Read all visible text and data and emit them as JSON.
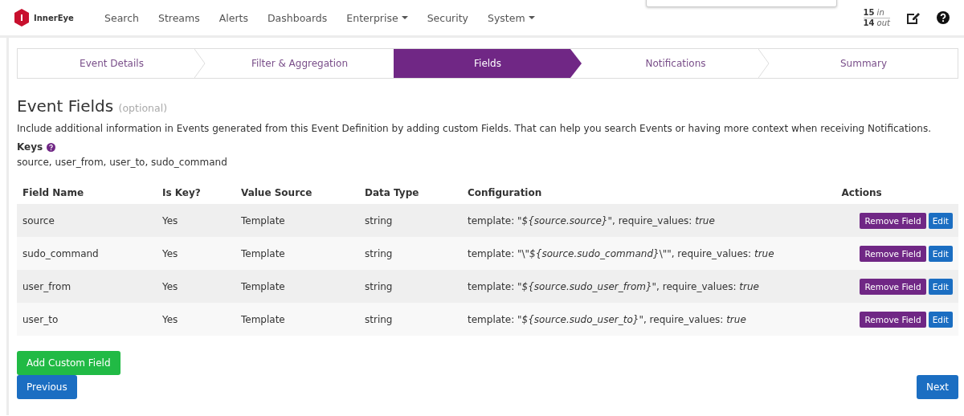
{
  "brand": "InnerEye",
  "nav": [
    {
      "label": "Search",
      "dropdown": false
    },
    {
      "label": "Streams",
      "dropdown": false
    },
    {
      "label": "Alerts",
      "dropdown": false
    },
    {
      "label": "Dashboards",
      "dropdown": false
    },
    {
      "label": "Enterprise",
      "dropdown": true
    },
    {
      "label": "Security",
      "dropdown": false
    },
    {
      "label": "System",
      "dropdown": true
    }
  ],
  "throughput": {
    "in_count": "15",
    "in_label": "in",
    "out_count": "14",
    "out_label": "out"
  },
  "steps": [
    {
      "label": "Event Details",
      "selected": false
    },
    {
      "label": "Filter & Aggregation",
      "selected": false
    },
    {
      "label": "Fields",
      "selected": true
    },
    {
      "label": "Notifications",
      "selected": false
    },
    {
      "label": "Summary",
      "selected": false
    }
  ],
  "heading": {
    "title": "Event Fields",
    "note": "(optional)"
  },
  "description": "Include additional information in Events generated from this Event Definition by adding custom Fields. That can help you search Events or having more context when receiving Notifications.",
  "keys": {
    "label": "Keys",
    "value": "source, user_from, user_to, sudo_command"
  },
  "table": {
    "columns": [
      "Field Name",
      "Is Key?",
      "Value Source",
      "Data Type",
      "Configuration",
      "Actions"
    ],
    "rows": [
      {
        "name": "source",
        "is_key": "Yes",
        "value_source": "Template",
        "data_type": "string",
        "configuration": "template: *\"${source.source}\"*, require_values: *true*",
        "actions": [
          "Remove Field",
          "Edit"
        ]
      },
      {
        "name": "sudo_command",
        "is_key": "Yes",
        "value_source": "Template",
        "data_type": "string",
        "configuration": "template: \"\\\"*${source.sudo_command}*\\\"\", require_values: *true*",
        "actions": [
          "Remove Field",
          "Edit"
        ]
      },
      {
        "name": "user_from",
        "is_key": "Yes",
        "value_source": "Template",
        "data_type": "string",
        "configuration": "template: *\"${source.sudo_user_from}\"*, require_values: *true*",
        "actions": [
          "Remove Field",
          "Edit"
        ]
      },
      {
        "name": "user_to",
        "is_key": "Yes",
        "value_source": "Template",
        "data_type": "string",
        "configuration": "template: *\"${source.sudo_user_to}\"*, require_values: *true*",
        "actions": [
          "Remove Field",
          "Edit"
        ]
      }
    ]
  },
  "add_button": "Add Custom Field",
  "previous_button": "Previous",
  "next_button": "Next"
}
